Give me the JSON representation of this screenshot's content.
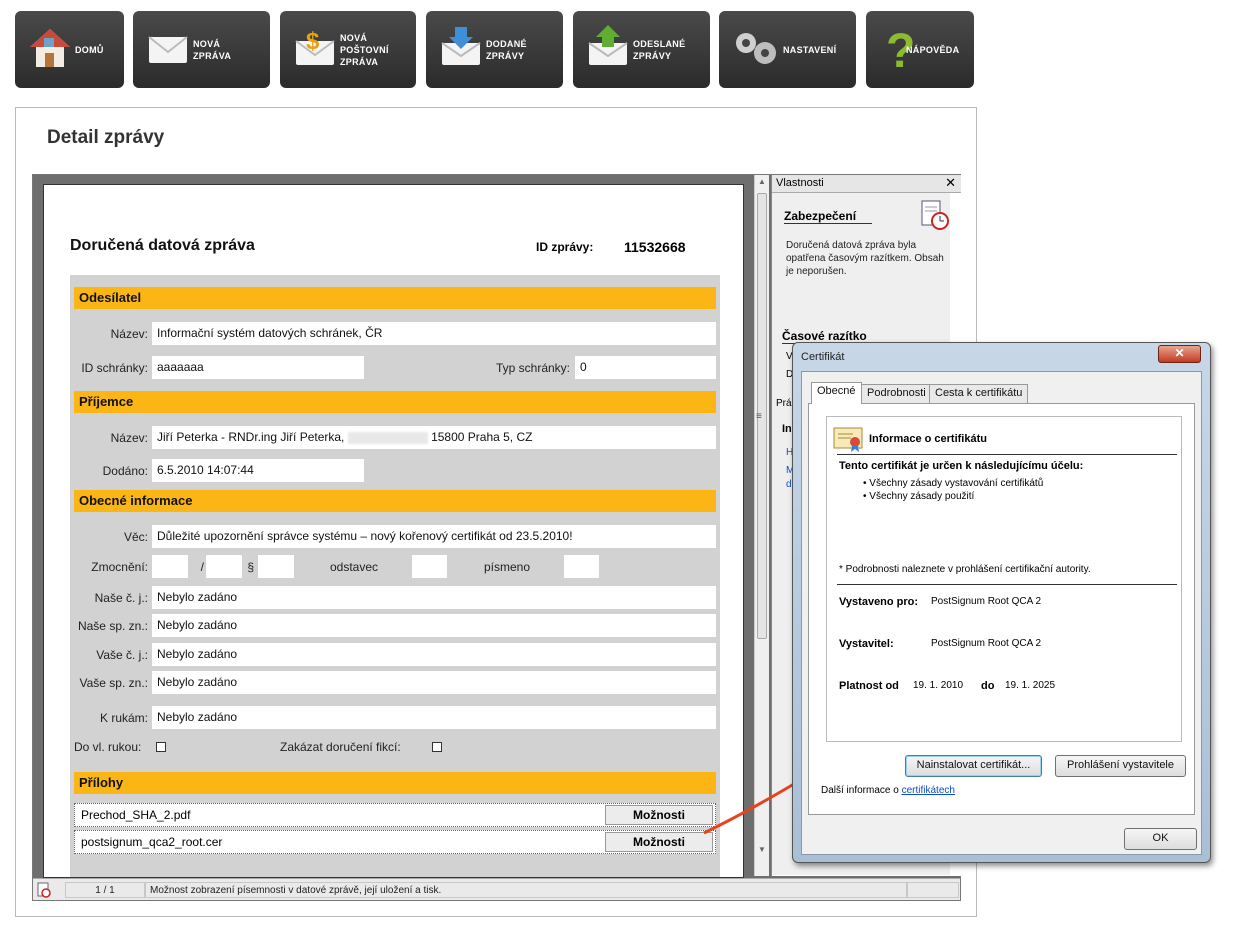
{
  "toolbar": {
    "items": [
      {
        "label": "DOMŮ",
        "icon": "home-icon"
      },
      {
        "label": "NOVÁ\nZPRÁVA",
        "icon": "envelope-icon"
      },
      {
        "label": "NOVÁ\nPOŠTOVNÍ\nZPRÁVA",
        "icon": "postal-envelope-icon"
      },
      {
        "label": "DODANÉ\nZPRÁVY",
        "icon": "inbox-icon"
      },
      {
        "label": "ODESLANÉ\nZPRÁVY",
        "icon": "outbox-icon"
      },
      {
        "label": "NASTAVENÍ",
        "icon": "gears-icon"
      },
      {
        "label": "NÁPOVĚDA",
        "icon": "question-icon"
      }
    ]
  },
  "page": {
    "title": "Detail zprávy"
  },
  "doc": {
    "title": "Doručená datová zpráva",
    "id_label": "ID zprávy:",
    "id_value": "11532668",
    "sender": {
      "heading": "Odesílatel",
      "name_label": "Název:",
      "name_value": "Informační systém datových schránek, ČR",
      "box_id_label": "ID schránky:",
      "box_id_value": "aaaaaaa",
      "box_type_label": "Typ schránky:",
      "box_type_value": "0"
    },
    "recipient": {
      "heading": "Příjemce",
      "name_label": "Název:",
      "name_value_a": "Jiří Peterka - RNDr.ing Jiří Peterka,",
      "name_value_b": "15800 Praha 5, CZ",
      "delivered_label": "Dodáno:",
      "delivered_value": "6.5.2010 14:07:44"
    },
    "general": {
      "heading": "Obecné informace",
      "subject_label": "Věc:",
      "subject_value": "Důležité upozornění správce systému – nový kořenový certifikát od 23.5.2010!",
      "auth_label": "Zmocnění:",
      "slash": "/",
      "para_sign": "§",
      "odstavec_label": "odstavec",
      "pismeno_label": "písmeno",
      "rows": [
        {
          "label": "Naše č. j.:",
          "value": "Nebylo zadáno"
        },
        {
          "label": "Naše sp. zn.:",
          "value": "Nebylo zadáno"
        },
        {
          "label": "Vaše č. j.:",
          "value": "Nebylo zadáno"
        },
        {
          "label": "Vaše sp. zn.:",
          "value": "Nebylo zadáno"
        },
        {
          "label": "K rukám:",
          "value": "Nebylo zadáno"
        }
      ],
      "personal_label": "Do vl. rukou:",
      "fiction_label": "Zakázat doručení fikcí:"
    },
    "attachments": {
      "heading": "Přílohy",
      "options_label": "Možnosti",
      "files": [
        "Prechod_SHA_2.pdf",
        "postsignum_qca2_root.cer"
      ]
    }
  },
  "status": {
    "pages": "1 / 1",
    "message": "Možnost zobrazení písemnosti v datové zprávě, její uložení a tisk."
  },
  "props": {
    "title": "Vlastnosti",
    "security_heading": "Zabezpečení",
    "security_text": "Doručená datová zpráva byla opatřena  časovým razítkem. Obsah je neporušen.",
    "timestamp_heading": "Časové razítko",
    "cut_a": "V",
    "cut_b": "D",
    "cut_c": "Prá",
    "cut_d": "In",
    "cut_e": "H",
    "cut_f": "M",
    "cut_g": "d"
  },
  "dialog": {
    "title": "Certifikát",
    "tabs": [
      "Obecné",
      "Podrobnosti",
      "Cesta k certifikátu"
    ],
    "info_heading": "Informace o certifikátu",
    "purpose_heading": "Tento certifikát je určen k následujícímu účelu:",
    "purposes": [
      "• Všechny zásady vystavování certifikátů",
      "• Všechny zásady použití"
    ],
    "footnote": "* Podrobnosti naleznete v prohlášení certifikační autority.",
    "issued_to_label": "Vystaveno pro:",
    "issued_to_value": "PostSignum Root QCA 2",
    "issuer_label": "Vystavitel:",
    "issuer_value": "PostSignum Root QCA 2",
    "valid_from_label": "Platnost od",
    "valid_from_value": "19. 1. 2010",
    "valid_to_label": "do",
    "valid_to_value": "19. 1. 2025",
    "install_label": "Nainstalovat certifikát...",
    "statement_label": "Prohlášení vystavitele",
    "more_prefix": "Další informace o",
    "more_link": "certifikátech",
    "ok_label": "OK"
  },
  "colors": {
    "section": "#fbb515",
    "arrow": "#e8431f",
    "toolbar": "#333333"
  }
}
